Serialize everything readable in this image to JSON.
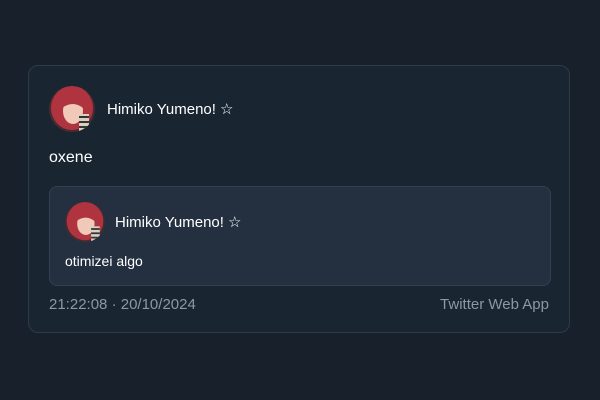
{
  "tweet": {
    "author_name": "Himiko Yumeno!",
    "author_badge": "☆",
    "text": "oxene",
    "quoted": {
      "author_name": "Himiko Yumeno!",
      "author_badge": "☆",
      "text": "otimizei algo"
    },
    "time": "21:22:08",
    "separator": "·",
    "date": "20/10/2024",
    "source": "Twitter Web App"
  },
  "colors": {
    "background": "#18202b",
    "card": "#1a2532",
    "quote_card": "#243040",
    "muted_text": "#8b98a5",
    "avatar_hair": "#b0343f"
  }
}
